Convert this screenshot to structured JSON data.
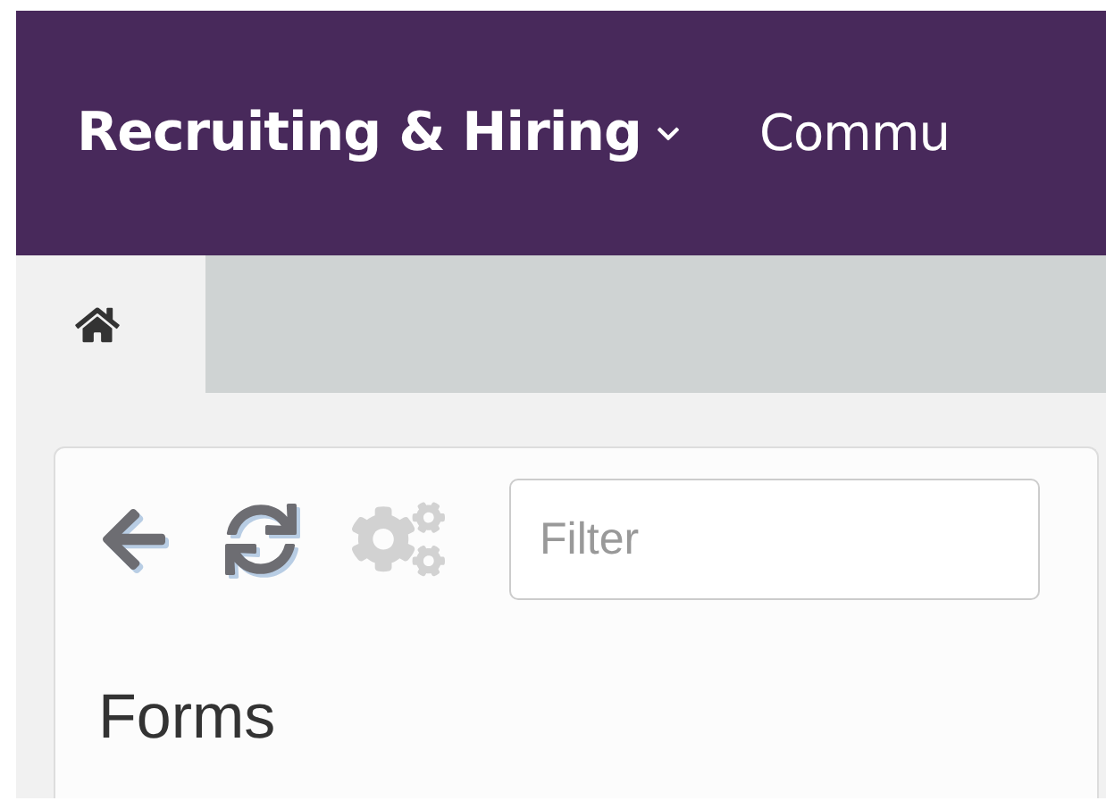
{
  "nav": [
    {
      "label": "Recruiting & Hiring",
      "dropdown": true,
      "selected": true
    },
    {
      "label": "Commu",
      "dropdown": false,
      "selected": false
    }
  ],
  "tabs": [
    {
      "kind": "home",
      "selected": true
    }
  ],
  "toolbar": {
    "tools": [
      {
        "kind": "back",
        "disabled": false
      },
      {
        "kind": "refresh",
        "disabled": false
      },
      {
        "kind": "settings",
        "disabled": true
      }
    ],
    "filter": {
      "placeholder": "Filter"
    }
  },
  "panel": {
    "title": "Forms"
  }
}
